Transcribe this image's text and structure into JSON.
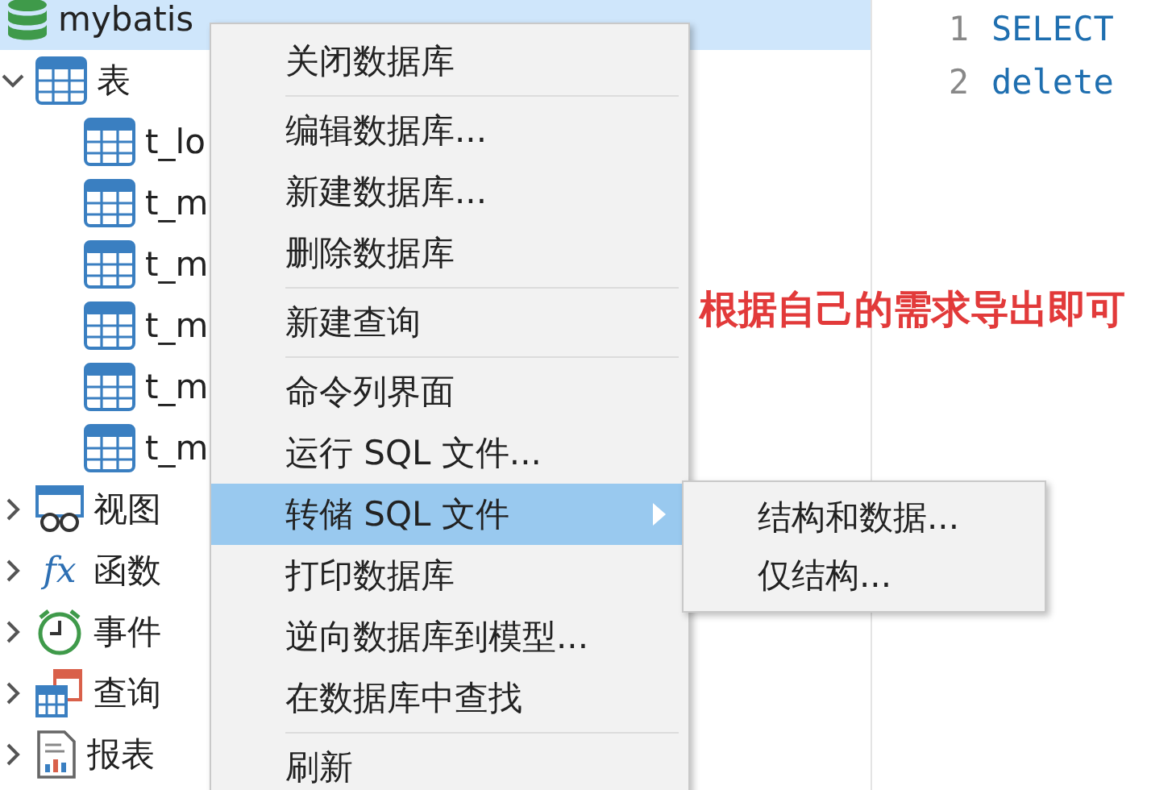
{
  "tree": {
    "database": {
      "name": "mybatis",
      "selected": true
    },
    "groups": [
      {
        "label": "表",
        "kind": "table",
        "expanded": true,
        "children": [
          {
            "name": "t_lo"
          },
          {
            "name": "t_m"
          },
          {
            "name": "t_m"
          },
          {
            "name": "t_m"
          },
          {
            "name": "t_m"
          },
          {
            "name": "t_m"
          }
        ]
      },
      {
        "label": "视图",
        "kind": "view",
        "expanded": false
      },
      {
        "label": "函数",
        "kind": "function",
        "icon_text": "fx",
        "expanded": false
      },
      {
        "label": "事件",
        "kind": "event",
        "expanded": false
      },
      {
        "label": "查询",
        "kind": "query",
        "expanded": false
      },
      {
        "label": "报表",
        "kind": "report",
        "expanded": false
      }
    ]
  },
  "editor": {
    "lines": [
      {
        "number": "1",
        "code": "SELECT"
      },
      {
        "number": "2",
        "code": "delete"
      }
    ]
  },
  "context_menu": {
    "items": [
      {
        "kind": "item",
        "label": "关闭数据库",
        "selected": false
      },
      {
        "kind": "separator"
      },
      {
        "kind": "item",
        "label": "编辑数据库...",
        "selected": false
      },
      {
        "kind": "item",
        "label": "新建数据库...",
        "selected": false
      },
      {
        "kind": "item",
        "label": "删除数据库",
        "selected": false
      },
      {
        "kind": "separator"
      },
      {
        "kind": "item",
        "label": "新建查询",
        "selected": false
      },
      {
        "kind": "separator"
      },
      {
        "kind": "item",
        "label": "命令列界面",
        "selected": false
      },
      {
        "kind": "item",
        "label": "运行 SQL 文件...",
        "selected": false
      },
      {
        "kind": "item",
        "label": "转储 SQL 文件",
        "selected": true,
        "submenu": true
      },
      {
        "kind": "item",
        "label": "打印数据库",
        "selected": false
      },
      {
        "kind": "item",
        "label": "逆向数据库到模型...",
        "selected": false
      },
      {
        "kind": "item",
        "label": "在数据库中查找",
        "selected": false
      },
      {
        "kind": "separator"
      },
      {
        "kind": "item",
        "label": "刷新",
        "selected": false
      }
    ]
  },
  "submenu": {
    "items": [
      {
        "label": "结构和数据...",
        "selected": false
      },
      {
        "label": "仅结构...",
        "selected": false
      }
    ]
  },
  "annotation": "根据自己的需求导出即可"
}
